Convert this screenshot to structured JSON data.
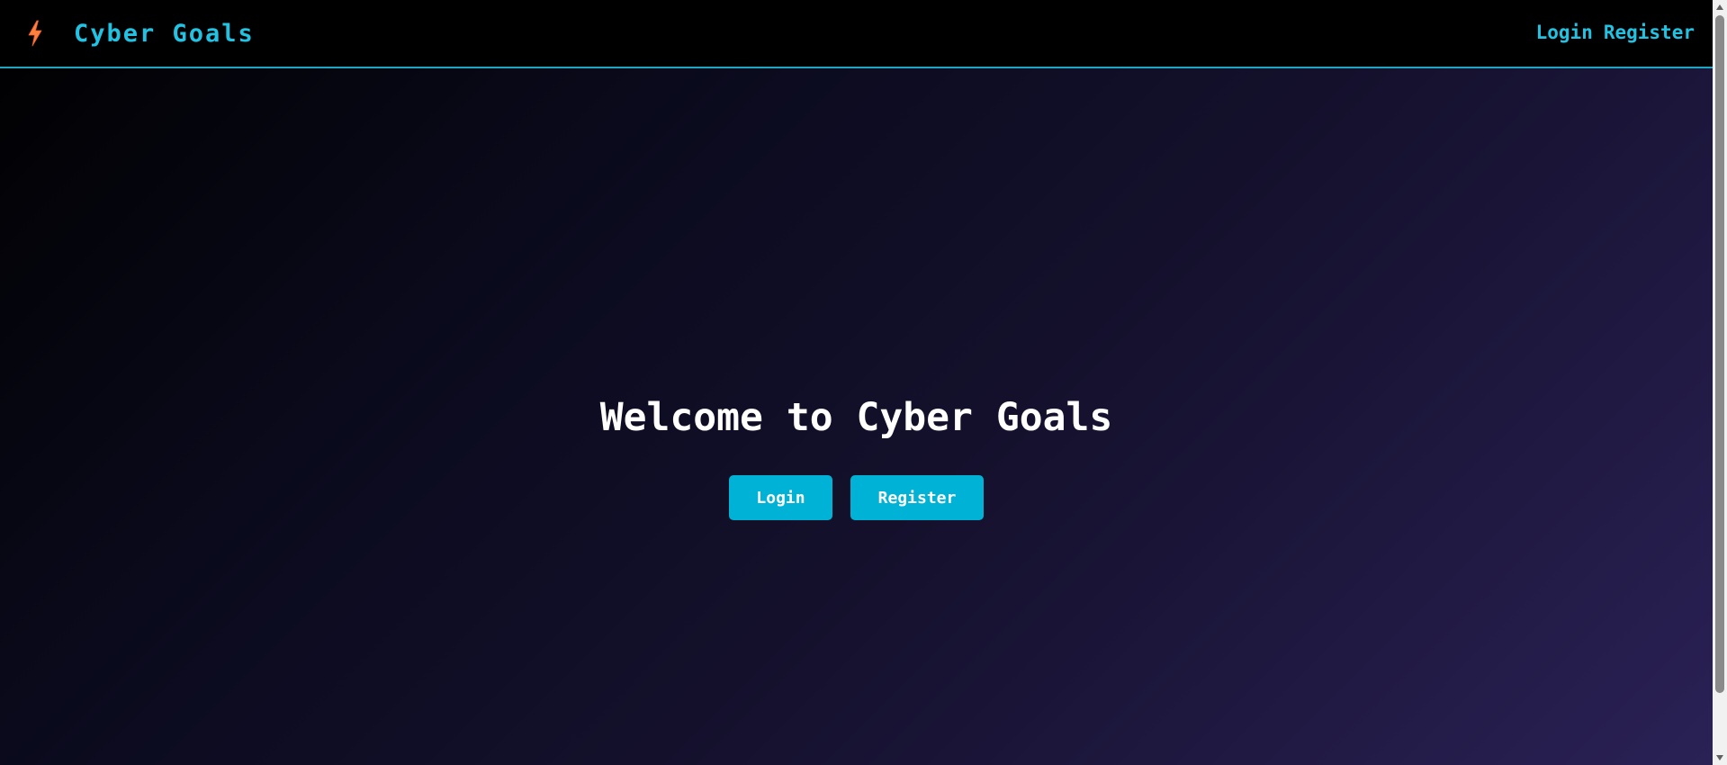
{
  "app": {
    "brand_name": "Cyber Goals",
    "brand_icon": "lightning-bolt-icon",
    "colors": {
      "accent": "#22c2e2",
      "button": "#00b3d6",
      "icon": "#ff7f3f",
      "navbar_bg": "#000000"
    }
  },
  "nav": {
    "links": [
      {
        "label": "Login"
      },
      {
        "label": "Register"
      }
    ]
  },
  "hero": {
    "title": "Welcome to Cyber Goals",
    "buttons": [
      {
        "label": "Login"
      },
      {
        "label": "Register"
      }
    ]
  },
  "scrollbar": {
    "up_icon": "scroll-up-arrow-icon",
    "down_icon": "scroll-down-arrow-icon"
  }
}
